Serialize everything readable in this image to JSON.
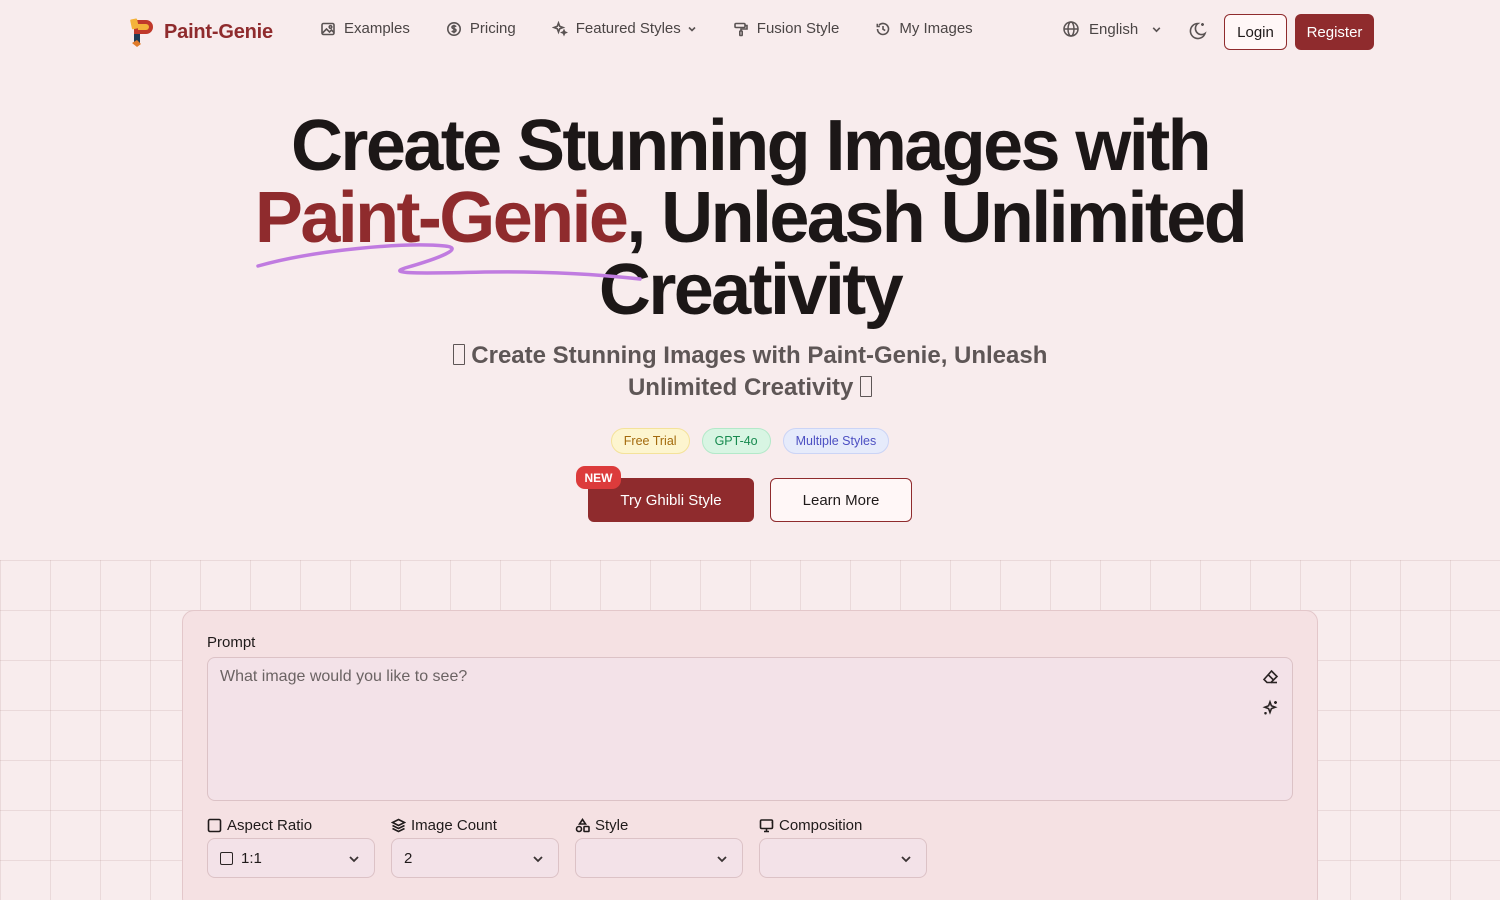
{
  "brand": {
    "name": "Paint-Genie",
    "primary_color": "#8f2b2d"
  },
  "nav": {
    "links": [
      {
        "label": "Examples",
        "icon": "image-icon"
      },
      {
        "label": "Pricing",
        "icon": "dollar-circle-icon"
      },
      {
        "label": "Featured Styles",
        "icon": "sparkles-icon",
        "has_dropdown": true
      },
      {
        "label": "Fusion Style",
        "icon": "paint-roller-icon"
      },
      {
        "label": "My Images",
        "icon": "history-icon"
      }
    ],
    "language": "English",
    "login": "Login",
    "register": "Register"
  },
  "hero": {
    "title_line1": "Create Stunning Images with",
    "title_brand": "Paint-Genie",
    "title_rest": ", Unleash Unlimited",
    "title_line3": "Creativity",
    "subtitle": "Create Stunning Images with Paint-Genie, Unleash Unlimited Creativity",
    "badges": [
      {
        "label": "Free Trial",
        "color": "#a36a0d"
      },
      {
        "label": "GPT-4o",
        "color": "#178a4f"
      },
      {
        "label": "Multiple Styles",
        "color": "#4c4fc2"
      }
    ],
    "new_tag": "NEW",
    "primary_cta": "Try Ghibli Style",
    "secondary_cta": "Learn More"
  },
  "form": {
    "prompt_label": "Prompt",
    "prompt_placeholder": "What image would you like to see?",
    "prompt_value": "",
    "options": {
      "aspect_ratio": {
        "label": "Aspect Ratio",
        "value": "1:1"
      },
      "image_count": {
        "label": "Image Count",
        "value": "2"
      },
      "style": {
        "label": "Style",
        "value": ""
      },
      "composition": {
        "label": "Composition",
        "value": ""
      }
    }
  }
}
